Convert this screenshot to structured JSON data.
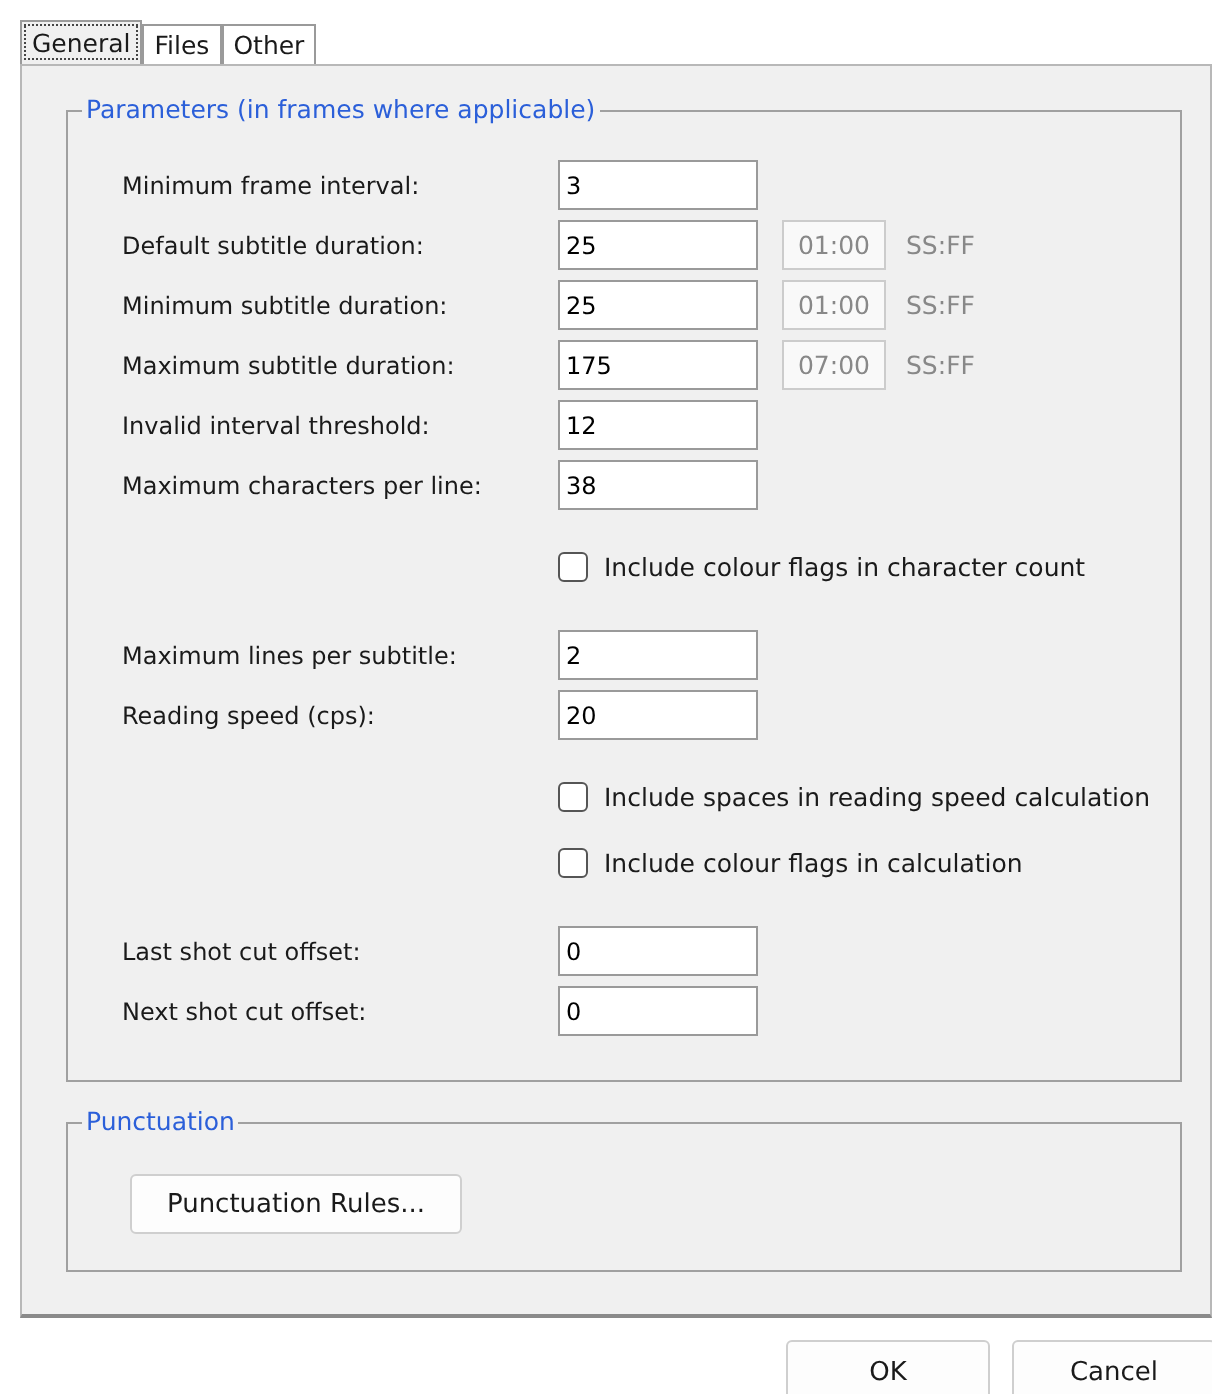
{
  "tabs": [
    {
      "label": "General",
      "selected": true
    },
    {
      "label": "Files",
      "selected": false
    },
    {
      "label": "Other",
      "selected": false
    }
  ],
  "parameters": {
    "title": "Parameters (in frames where applicable)",
    "items": [
      {
        "kind": "field",
        "label": "Minimum frame interval:",
        "value": "3"
      },
      {
        "kind": "field",
        "label": "Default subtitle duration:",
        "value": "25",
        "time": {
          "value": "01:00",
          "unit": "SS:FF",
          "disabled": true
        }
      },
      {
        "kind": "field",
        "label": "Minimum subtitle duration:",
        "value": "25",
        "time": {
          "value": "01:00",
          "unit": "SS:FF",
          "disabled": true
        }
      },
      {
        "kind": "field",
        "label": "Maximum subtitle duration:",
        "value": "175",
        "time": {
          "value": "07:00",
          "unit": "SS:FF",
          "disabled": true
        }
      },
      {
        "kind": "field",
        "label": "Invalid interval threshold:",
        "value": "12"
      },
      {
        "kind": "field",
        "label": "Maximum characters per line:",
        "value": "38"
      },
      {
        "kind": "checkbox",
        "label": "Include colour flags in character count",
        "checked": false
      },
      {
        "kind": "field",
        "label": "Maximum lines per subtitle:",
        "value": "2"
      },
      {
        "kind": "field",
        "label": "Reading speed (cps):",
        "value": "20"
      },
      {
        "kind": "checkbox",
        "label": "Include spaces in reading speed calculation",
        "checked": false
      },
      {
        "kind": "checkbox",
        "label": "Include colour flags in calculation",
        "checked": false
      },
      {
        "kind": "field",
        "label": "Last shot cut offset:",
        "value": "0"
      },
      {
        "kind": "field",
        "label": "Next shot cut offset:",
        "value": "0"
      }
    ]
  },
  "punctuation": {
    "title": "Punctuation",
    "button": "Punctuation Rules..."
  },
  "buttons": [
    "OK",
    "Cancel"
  ]
}
